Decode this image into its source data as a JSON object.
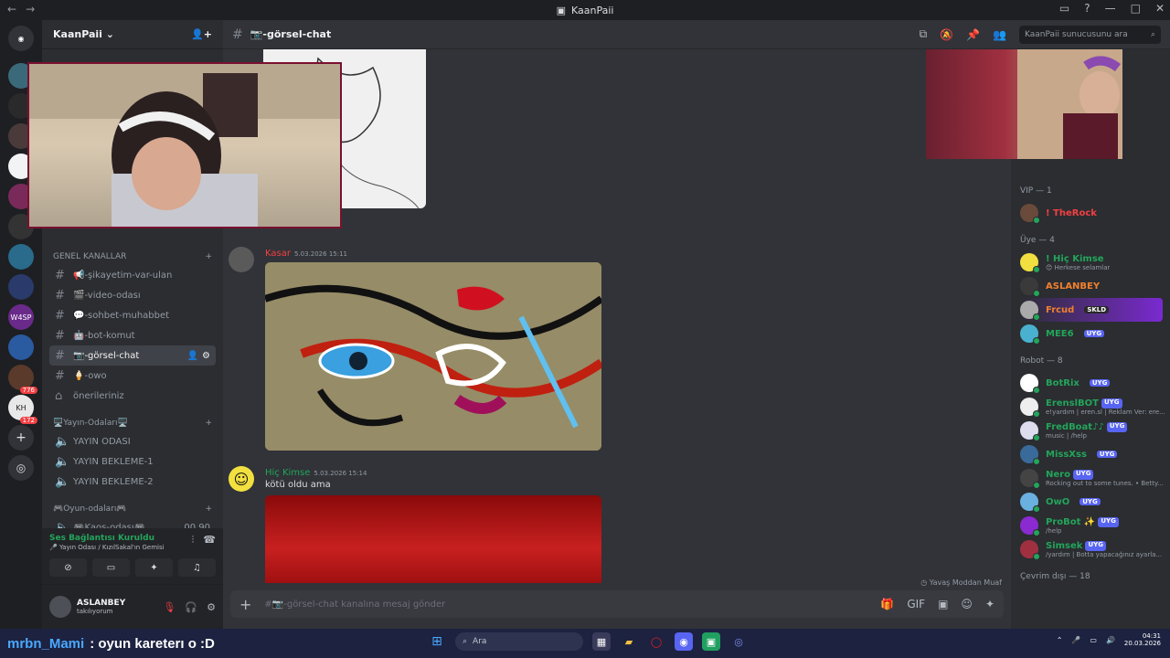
{
  "app": {
    "title": "KaanPaii"
  },
  "server": {
    "name": "KaanPaii"
  },
  "categories": [
    {
      "label": "GENEL KANALLAR"
    },
    {
      "label": "🖥️Yayın-Odaları🖥️"
    },
    {
      "label": "🎮Oyun-odaları🎮"
    }
  ],
  "channels": [
    {
      "label": "📢-şikayetim-var-ulan"
    },
    {
      "label": "🎬-video-odası"
    },
    {
      "label": "💬-sohbet-muhabbet"
    },
    {
      "label": "🤖-bot-komut"
    },
    {
      "label": "📷-görsel-chat"
    },
    {
      "label": "🍦-owo"
    },
    {
      "label": "önerileriniz"
    }
  ],
  "voice": [
    {
      "label": "YAYIN ODASI"
    },
    {
      "label": "YAYIN BEKLEME-1"
    },
    {
      "label": "YAYIN BEKLEME-2"
    },
    {
      "label": "🎮Kaos-odası🎮",
      "counts": "00  90"
    }
  ],
  "voice_panel": {
    "status": "Ses Bağlantısı Kuruldu",
    "sub": "🎤 Yayın Odası / KızılSakal'ın Gemisi"
  },
  "user": {
    "name": "ASLANBEY",
    "status": "takılıyorum"
  },
  "channel_header": {
    "name": "📷-görsel-chat"
  },
  "search": {
    "placeholder": "KaanPaii sunucusunu ara"
  },
  "messages": [
    {
      "author": "Kasar",
      "time": "5.03.2026 15:11",
      "text": "",
      "color": "#f23f43"
    },
    {
      "author": "Hiç Kimse",
      "time": "5.03.2026 15:14",
      "text": "kötü oldu ama",
      "color": "#23a55a"
    }
  ],
  "composer": {
    "placeholder": "#📷-görsel-chat kanalına mesaj gönder"
  },
  "typing": "Yavaş Moddan Muaf",
  "member_groups": [
    {
      "label": "VIP — 1",
      "members": [
        {
          "name": "! TheRock",
          "sub": "",
          "color": "#f23f43"
        }
      ]
    },
    {
      "label": "Üye — 4",
      "members": [
        {
          "name": "! Hiç Kimse",
          "sub": "😊 Herkese selamlar",
          "color": "#23a55a"
        },
        {
          "name": "ASLANBEY",
          "sub": "",
          "color": "#f0802e"
        },
        {
          "name": "Frcud",
          "sub": "",
          "color": "#f0802e",
          "tag": "SKLD"
        },
        {
          "name": "MEE6",
          "sub": "",
          "color": "#23a55a",
          "tag": "UYG"
        }
      ]
    },
    {
      "label": "Robot — 8",
      "members": [
        {
          "name": "BotRix",
          "sub": "",
          "color": "#23a55a",
          "tag": "UYG"
        },
        {
          "name": "ErenslBOT",
          "sub": "e!yardım | eren.sl | Reklam Ver: ere...",
          "color": "#23a55a",
          "tag": "UYG"
        },
        {
          "name": "FredBoat♪♪",
          "sub": "music | /help",
          "color": "#23a55a",
          "tag": "UYG"
        },
        {
          "name": "MissXss",
          "sub": "",
          "color": "#23a55a",
          "tag": "UYG"
        },
        {
          "name": "Nero",
          "sub": "Rocking out to some tunes. • Betty...",
          "color": "#23a55a",
          "tag": "UYG"
        },
        {
          "name": "OwO",
          "sub": "",
          "color": "#23a55a",
          "tag": "UYG"
        },
        {
          "name": "ProBot ✨",
          "sub": "/help",
          "color": "#23a55a",
          "tag": "UYG"
        },
        {
          "name": "Simsek",
          "sub": "/yardım | Botta yapacağınız ayarla...",
          "color": "#23a55a",
          "tag": "UYG"
        }
      ]
    },
    {
      "label": "Çevrim dışı — 18",
      "members": []
    }
  ],
  "guild_badges": [
    "776",
    "172"
  ],
  "guild_labels": [
    "W4SP",
    "KH"
  ],
  "ticker": {
    "user": "mrbn_Mami",
    "text": ": oyun karetеrı o :D"
  },
  "taskbar": {
    "search": "Ara",
    "time": "04:31",
    "date": "20.03.2026"
  }
}
